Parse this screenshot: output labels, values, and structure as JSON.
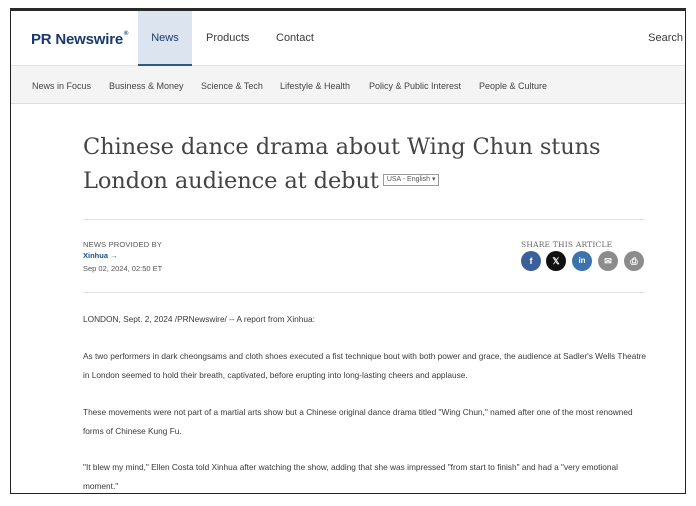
{
  "brand": {
    "logo": "PR Newswire",
    "mark": "®"
  },
  "nav": {
    "news": "News",
    "products": "Products",
    "contact": "Contact",
    "search": "Search"
  },
  "categories": [
    "News in Focus",
    "Business & Money",
    "Science & Tech",
    "Lifestyle & Health",
    "Policy & Public Interest",
    "People & Culture"
  ],
  "article": {
    "title": "Chinese dance drama about Wing Chun stuns London audience at debut",
    "language": "USA - English ▾",
    "provided_by_label": "NEWS PROVIDED BY",
    "source": "Xinhua →",
    "date": "Sep 02, 2024, 02:50 ET",
    "share_label": "SHARE THIS ARTICLE",
    "paragraphs": [
      "LONDON, Sept. 2, 2024 /PRNewswire/ -- A report from Xinhua:",
      "As two performers in dark cheongsams and cloth shoes executed a fist technique bout with both power and grace, the audience at Sadler's Wells Theatre in London seemed to hold their breath, captivated, before erupting into long-lasting cheers and applause.",
      "These movements were not part of a martial arts show but a Chinese original dance drama titled \"Wing Chun,\" named after one of the most renowned forms of Chinese Kung Fu.",
      "\"It blew my mind,\" Ellen Costa told Xinhua after watching the show, adding that she was impressed \"from start to finish\" and had a \"very emotional moment.\""
    ]
  },
  "share_icons": {
    "facebook": "f",
    "x": "𝕏",
    "linkedin": "in",
    "email": "✉",
    "print": "⎙"
  },
  "colors": {
    "brand_navy": "#1b3a6b",
    "link_blue": "#1b4f8a",
    "active_tab_bg": "#dbe4ef",
    "accent_orange": "#e8773b"
  }
}
